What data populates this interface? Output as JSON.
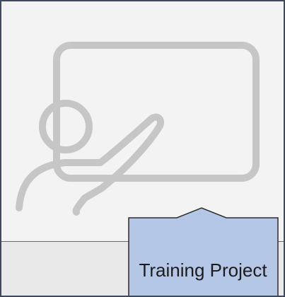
{
  "project": {
    "name": "Training Project",
    "icon": "presenter-at-whiteboard-icon"
  },
  "colors": {
    "tile_background": "#f3f3f3",
    "tile_border": "#3f4a5e",
    "icon_stroke": "#c6c6c6",
    "callout_fill": "#b4c7e7",
    "callout_border": "#2b2b2b",
    "text": "#1c1c1c"
  }
}
